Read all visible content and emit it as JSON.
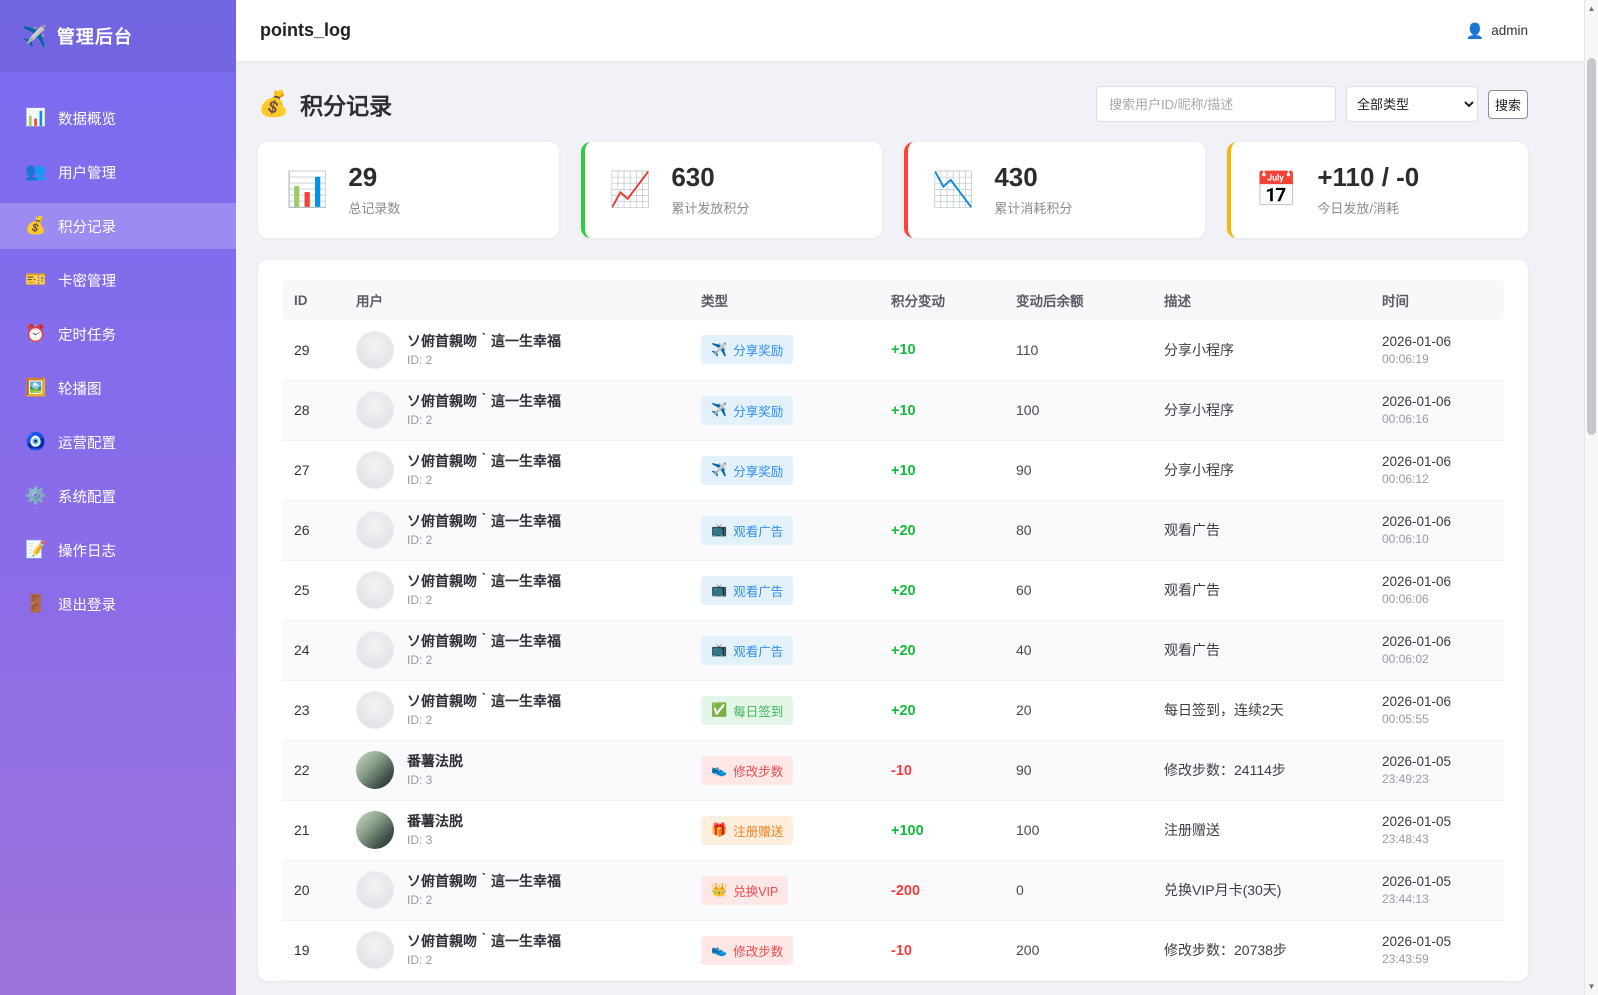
{
  "brand": {
    "icon": "✈️",
    "title": "管理后台"
  },
  "sidebar": {
    "items": [
      {
        "key": "data-overview",
        "icon": "📊",
        "label": "数据概览",
        "active": false
      },
      {
        "key": "user-management",
        "icon": "👥",
        "label": "用户管理",
        "active": false
      },
      {
        "key": "points-log",
        "icon": "💰",
        "label": "积分记录",
        "active": true
      },
      {
        "key": "card-key-management",
        "icon": "🎫",
        "label": "卡密管理",
        "active": false
      },
      {
        "key": "scheduled-tasks",
        "icon": "⏰",
        "label": "定时任务",
        "active": false
      },
      {
        "key": "carousel",
        "icon": "🖼️",
        "label": "轮播图",
        "active": false
      },
      {
        "key": "operation-config",
        "icon": "🧿",
        "label": "运营配置",
        "active": false
      },
      {
        "key": "system-config",
        "icon": "⚙️",
        "label": "系统配置",
        "active": false
      },
      {
        "key": "operation-logs",
        "icon": "📝",
        "label": "操作日志",
        "active": false
      },
      {
        "key": "logout",
        "icon": "🚪",
        "label": "退出登录",
        "active": false
      }
    ]
  },
  "topbar": {
    "title": "points_log",
    "user_icon": "👤",
    "user_name": "admin"
  },
  "page": {
    "icon": "💰",
    "title": "积分记录"
  },
  "filters": {
    "search_placeholder": "搜索用户ID/昵称/描述",
    "type_selected": "全部类型",
    "search_button": "搜索"
  },
  "stats": [
    {
      "icon": "📊",
      "value": "29",
      "label": "总记录数",
      "accent": "transparent"
    },
    {
      "icon": "📈",
      "value": "630",
      "label": "累计发放积分",
      "accent": "#2ecc40"
    },
    {
      "icon": "📉",
      "value": "430",
      "label": "累计消耗积分",
      "accent": "#ff4136"
    },
    {
      "icon": "📅",
      "value": "+110 / -0",
      "label": "今日发放/消耗",
      "accent": "#f5b50a"
    }
  ],
  "table": {
    "headers": [
      "ID",
      "用户",
      "类型",
      "积分变动",
      "变动后余额",
      "描述",
      "时间"
    ],
    "rows": [
      {
        "id": "29",
        "user": "ソ俯首親吻｀這一生幸福",
        "user_id": "ID: 2",
        "avatar": "gray",
        "type": "分享奖励",
        "type_icon": "✈️",
        "type_style": "blue",
        "change": "+10",
        "balance": "110",
        "desc": "分享小程序",
        "date": "2026-01-06",
        "time": "00:06:19"
      },
      {
        "id": "28",
        "user": "ソ俯首親吻｀這一生幸福",
        "user_id": "ID: 2",
        "avatar": "gray",
        "type": "分享奖励",
        "type_icon": "✈️",
        "type_style": "blue",
        "change": "+10",
        "balance": "100",
        "desc": "分享小程序",
        "date": "2026-01-06",
        "time": "00:06:16"
      },
      {
        "id": "27",
        "user": "ソ俯首親吻｀這一生幸福",
        "user_id": "ID: 2",
        "avatar": "gray",
        "type": "分享奖励",
        "type_icon": "✈️",
        "type_style": "blue",
        "change": "+10",
        "balance": "90",
        "desc": "分享小程序",
        "date": "2026-01-06",
        "time": "00:06:12"
      },
      {
        "id": "26",
        "user": "ソ俯首親吻｀這一生幸福",
        "user_id": "ID: 2",
        "avatar": "gray",
        "type": "观看广告",
        "type_icon": "📺",
        "type_style": "blue",
        "change": "+20",
        "balance": "80",
        "desc": "观看广告",
        "date": "2026-01-06",
        "time": "00:06:10"
      },
      {
        "id": "25",
        "user": "ソ俯首親吻｀這一生幸福",
        "user_id": "ID: 2",
        "avatar": "gray",
        "type": "观看广告",
        "type_icon": "📺",
        "type_style": "blue",
        "change": "+20",
        "balance": "60",
        "desc": "观看广告",
        "date": "2026-01-06",
        "time": "00:06:06"
      },
      {
        "id": "24",
        "user": "ソ俯首親吻｀這一生幸福",
        "user_id": "ID: 2",
        "avatar": "gray",
        "type": "观看广告",
        "type_icon": "📺",
        "type_style": "blue",
        "change": "+20",
        "balance": "40",
        "desc": "观看广告",
        "date": "2026-01-06",
        "time": "00:06:02"
      },
      {
        "id": "23",
        "user": "ソ俯首親吻｀這一生幸福",
        "user_id": "ID: 2",
        "avatar": "gray",
        "type": "每日签到",
        "type_icon": "✅",
        "type_style": "green",
        "change": "+20",
        "balance": "20",
        "desc": "每日签到，连续2天",
        "date": "2026-01-06",
        "time": "00:05:55"
      },
      {
        "id": "22",
        "user": "番薯法脱",
        "user_id": "ID: 3",
        "avatar": "photo",
        "type": "修改步数",
        "type_icon": "👟",
        "type_style": "red",
        "change": "-10",
        "balance": "90",
        "desc": "修改步数：24114步",
        "date": "2026-01-05",
        "time": "23:49:23"
      },
      {
        "id": "21",
        "user": "番薯法脱",
        "user_id": "ID: 3",
        "avatar": "photo",
        "type": "注册赠送",
        "type_icon": "🎁",
        "type_style": "orange",
        "change": "+100",
        "balance": "100",
        "desc": "注册赠送",
        "date": "2026-01-05",
        "time": "23:48:43"
      },
      {
        "id": "20",
        "user": "ソ俯首親吻｀這一生幸福",
        "user_id": "ID: 2",
        "avatar": "gray",
        "type": "兑换VIP",
        "type_icon": "👑",
        "type_style": "red",
        "change": "-200",
        "balance": "0",
        "desc": "兑换VIP月卡(30天)",
        "date": "2026-01-05",
        "time": "23:44:13"
      },
      {
        "id": "19",
        "user": "ソ俯首親吻｀這一生幸福",
        "user_id": "ID: 2",
        "avatar": "gray",
        "type": "修改步数",
        "type_icon": "👟",
        "type_style": "red",
        "change": "-10",
        "balance": "200",
        "desc": "修改步数：20738步",
        "date": "2026-01-05",
        "time": "23:43:59"
      }
    ]
  },
  "scrollbar": {
    "up": "▲",
    "down": "▼"
  },
  "colors": {
    "sidebar_gradient_top": "#7a6cf0",
    "sidebar_gradient_bottom": "#9d74da",
    "positive_change": "#15b93c",
    "negative_change": "#f03e3e",
    "stat_accent_green": "#2ecc40",
    "stat_accent_red": "#ff4136",
    "stat_accent_yellow": "#f5b50a"
  }
}
